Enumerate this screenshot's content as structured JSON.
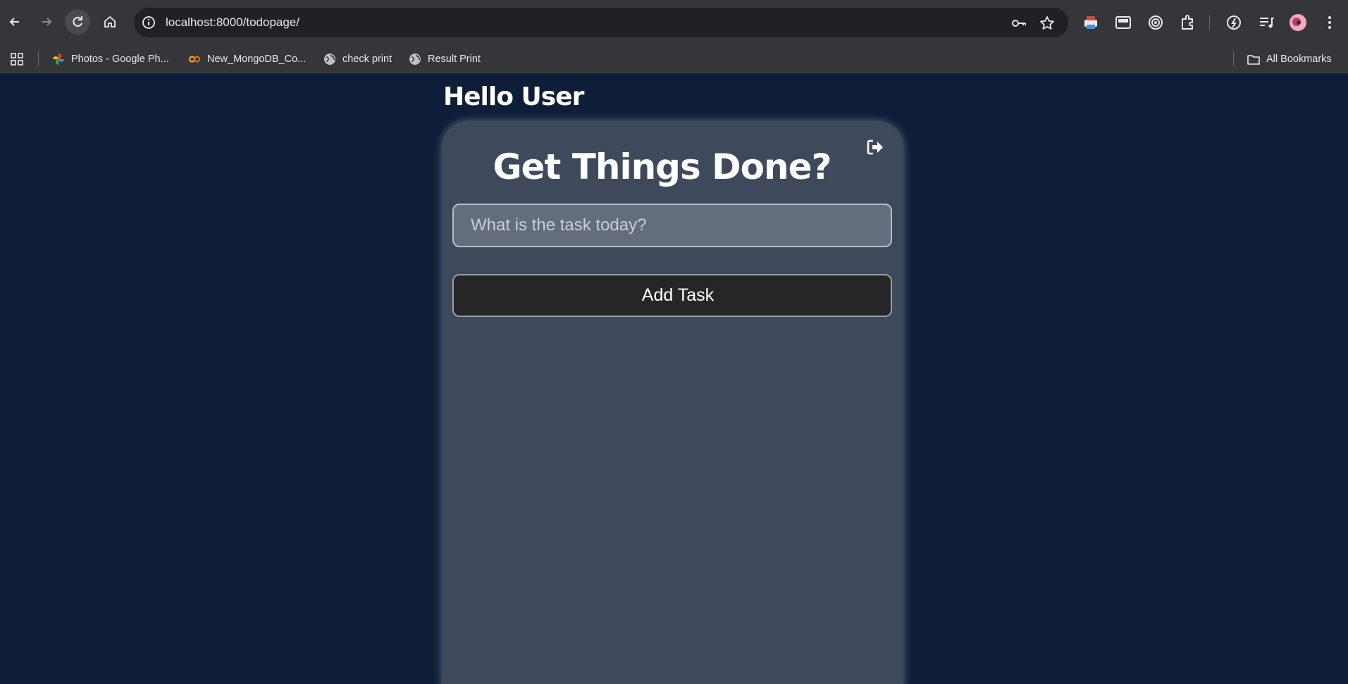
{
  "browser": {
    "url": "localhost:8000/todopage/",
    "bookmarks": [
      {
        "label": "Photos - Google Ph...",
        "icon": "google-photos-icon"
      },
      {
        "label": "New_MongoDB_Co...",
        "icon": "colab-icon"
      },
      {
        "label": "check print",
        "icon": "globe-icon"
      },
      {
        "label": "Result Print",
        "icon": "globe-icon"
      }
    ],
    "all_bookmarks_label": "All Bookmarks"
  },
  "page": {
    "greeting": "Hello User",
    "title": "Get Things Done?",
    "task_input": {
      "placeholder": "What is the task today?",
      "value": ""
    },
    "add_button_label": "Add Task"
  },
  "colors": {
    "background": "#0f1e38",
    "card": "#3e4a5c",
    "input": "#646d7d",
    "button": "#262626"
  }
}
